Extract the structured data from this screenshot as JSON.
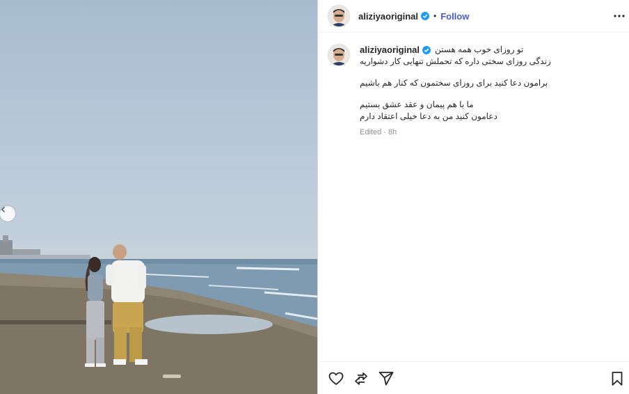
{
  "post": {
    "username": "aliziyaoriginal",
    "follow_label": "Follow",
    "separator": "•"
  },
  "caption": {
    "username": "aliziyaoriginal",
    "lines": [
      "تو روزای خوب همه هستن",
      "زندگی روزای سختی داره که تحملش تنهایی کار دشواریه",
      "برامون دعا کنید برای روزای سختمون که کنار هم باشیم",
      "ما با هم پیمان و عقد عشق بستیم",
      "دعامون کنید من به دعا خیلی اعتقاد دارم"
    ],
    "meta": "Edited · 8h"
  },
  "icons": {
    "verified": "verified-badge-icon",
    "more": "more-options-icon",
    "like": "heart-icon",
    "comment": "comment-icon",
    "share": "share-icon",
    "save": "bookmark-icon",
    "carousel": "chevron-left-icon"
  },
  "colors": {
    "follow": "#4a5ad6",
    "verified": "#1d9bf0",
    "meta": "#8e8e8e"
  }
}
